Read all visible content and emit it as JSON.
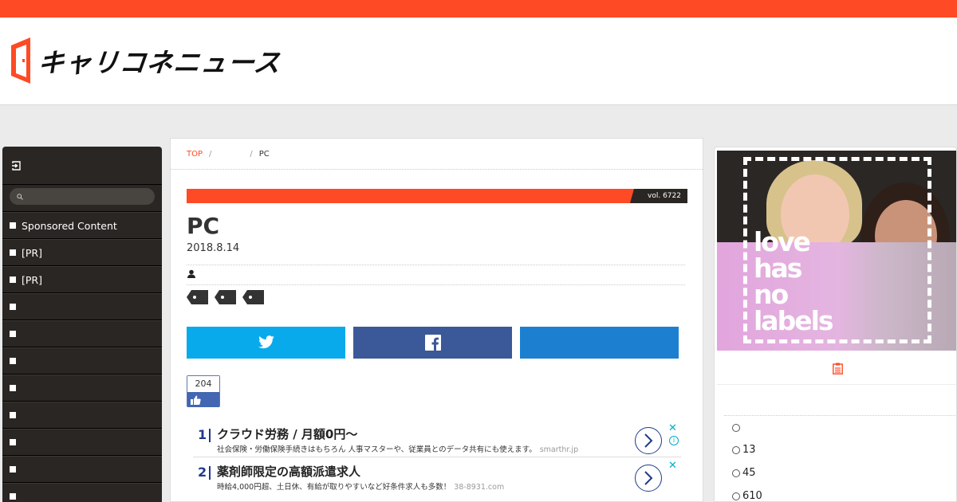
{
  "header": {
    "logo_text": "キャリコネニュース",
    "logo_door_color": "#fe4a25",
    "brand_color": "#fe4a25"
  },
  "sidebar": {
    "login_icon": "login-icon",
    "search_placeholder": "",
    "items": [
      {
        "label": "Sponsored Content"
      },
      {
        "label": "[PR]"
      },
      {
        "label": "[PR]"
      },
      {
        "label": ""
      },
      {
        "label": ""
      },
      {
        "label": ""
      },
      {
        "label": ""
      },
      {
        "label": ""
      },
      {
        "label": ""
      },
      {
        "label": ""
      },
      {
        "label": ""
      }
    ]
  },
  "breadcrumb": {
    "top": "TOP",
    "sep1": "/",
    "middle": "",
    "sep2": "/",
    "current": "PC"
  },
  "article": {
    "vol": "vol. 6722",
    "title": "PC",
    "date": "2018.8.14",
    "tags_count": 3
  },
  "share": {
    "twitter_icon": "twitter-icon",
    "facebook_icon": "facebook-icon",
    "hatena_icon": "hatena-icon"
  },
  "like": {
    "count": "204"
  },
  "ads": [
    {
      "num": "1",
      "title": "クラウド労務 / 月額0円〜",
      "desc": "社会保険・労働保険手続きはもちろん 人事マスターや、従業員とのデータ共有にも使えます。",
      "domain": "smarthr.jp"
    },
    {
      "num": "2",
      "title": "薬剤師限定の高額派遣求人",
      "desc": "時給4,000円超、土日休、有給が取りやすいなど好条件求人も多数！",
      "domain": "38-8931.com"
    }
  ],
  "ad_controls": {
    "close": "✕",
    "info": "i"
  },
  "right": {
    "banner_text": [
      "love",
      "has",
      "no",
      "labels"
    ],
    "tab_icon": "clipboard-icon",
    "rank_items": [
      "",
      "13",
      "45",
      "610"
    ]
  }
}
